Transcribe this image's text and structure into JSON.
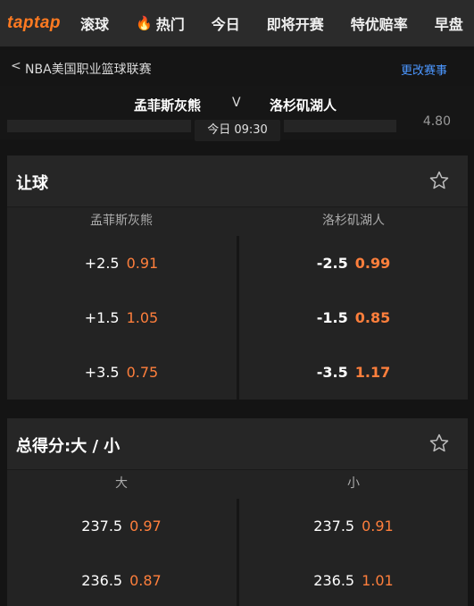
{
  "nav": {
    "logo": "taptap",
    "items": [
      "滚球",
      "热门",
      "今日",
      "即将开赛",
      "特优赔率",
      "早盘"
    ]
  },
  "breadcrumb": {
    "back_icon": "chevron-left-icon",
    "league": "NBA美国职业篮球联赛",
    "change_label": "更改赛事"
  },
  "match": {
    "home": "孟菲斯灰熊",
    "vs": "V",
    "away": "洛杉矶湖人",
    "time": "今日 09:30",
    "peek_odds": "4.80"
  },
  "spread": {
    "title": "让球",
    "home_header": "孟菲斯灰熊",
    "away_header": "洛杉矶湖人",
    "rows": [
      {
        "home_line": "+2.5",
        "home_price": "0.91",
        "away_line": "-2.5",
        "away_price": "0.99"
      },
      {
        "home_line": "+1.5",
        "home_price": "1.05",
        "away_line": "-1.5",
        "away_price": "0.85"
      },
      {
        "home_line": "+3.5",
        "home_price": "0.75",
        "away_line": "-3.5",
        "away_price": "1.17"
      }
    ]
  },
  "totals": {
    "title": "总得分:大 / 小",
    "over_header": "大",
    "under_header": "小",
    "rows": [
      {
        "over_line": "237.5",
        "over_price": "0.97",
        "under_line": "237.5",
        "under_price": "0.91"
      },
      {
        "over_line": "236.5",
        "over_price": "0.87",
        "under_line": "236.5",
        "under_price": "1.01"
      }
    ]
  },
  "colors": {
    "accent": "#ff7f3c",
    "link": "#4c97ff",
    "logo": "#ff7a21"
  }
}
